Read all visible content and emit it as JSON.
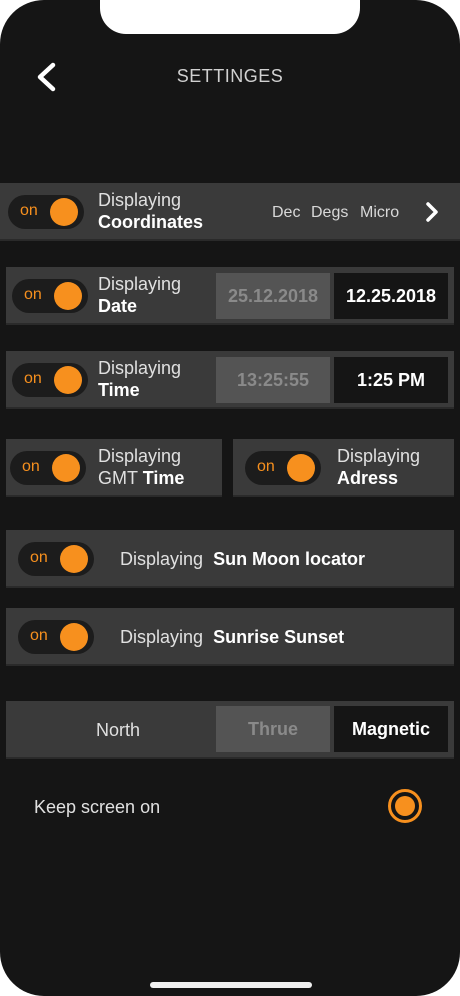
{
  "header": {
    "title": "SETTINGES"
  },
  "toggle_on_label": "on",
  "coordinates": {
    "label_top": "Displaying",
    "label_bold": "Coordinates",
    "formats": [
      "Dec",
      "Degs",
      "Micro"
    ],
    "enabled": true
  },
  "date": {
    "label_top": "Displaying",
    "label_bold": "Date",
    "option_inactive": "25.12.2018",
    "option_active": "12.25.2018",
    "enabled": true
  },
  "time": {
    "label_top": "Displaying",
    "label_bold": "Time",
    "option_inactive": "13:25:55",
    "option_active": "1:25 PM",
    "enabled": true
  },
  "gmt_time": {
    "label_top": "Displaying",
    "label_plain": "GMT",
    "label_bold": "Time",
    "enabled": true
  },
  "address": {
    "label_top": "Displaying",
    "label_bold": "Adress",
    "enabled": true
  },
  "sun_moon": {
    "label_plain": "Displaying",
    "label_bold": "Sun Moon locator",
    "enabled": true
  },
  "sunrise": {
    "label_plain": "Displaying",
    "label_bold": "Sunrise Sunset",
    "enabled": true
  },
  "north": {
    "label": "North",
    "option_inactive": "Thrue",
    "option_active": "Magnetic"
  },
  "keep_screen": {
    "label": "Keep screen on",
    "selected": true
  },
  "colors": {
    "accent": "#f7901e",
    "background": "#151515",
    "row": "#3a3a3a"
  }
}
